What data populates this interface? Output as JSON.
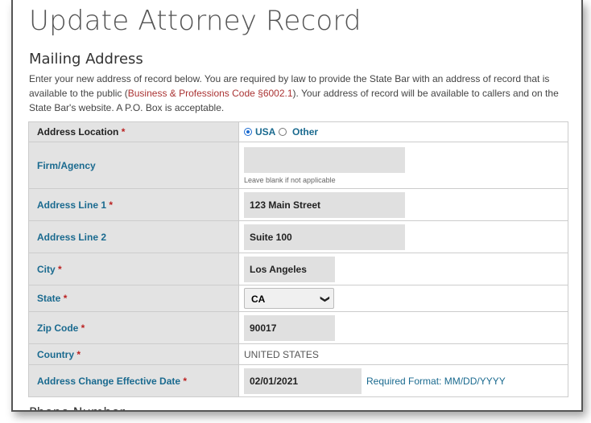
{
  "page": {
    "title": "Update Attorney Record",
    "section_title": "Mailing Address",
    "intro_1": "Enter your new address of record below. You are required by law to provide the State Bar with an address of record that is available to the public (",
    "intro_link": "Business & Professions Code §6002.1",
    "intro_2": "). Your address of record will be available to callers and on the State Bar's website. A P.O. Box is acceptable.",
    "next_section_partial": "Phone Number"
  },
  "form": {
    "address_location": {
      "label": "Address Location",
      "req": "*",
      "options": [
        "USA",
        "Other"
      ],
      "selected": "USA"
    },
    "firm": {
      "label": "Firm/Agency",
      "value": "",
      "hint": "Leave blank if not applicable"
    },
    "line1": {
      "label": "Address Line 1",
      "req": "*",
      "value": "123 Main Street"
    },
    "line2": {
      "label": "Address Line 2",
      "value": "Suite 100"
    },
    "city": {
      "label": "City",
      "req": "*",
      "value": "Los Angeles"
    },
    "state": {
      "label": "State",
      "req": "*",
      "value": "CA"
    },
    "zip": {
      "label": "Zip Code",
      "req": "*",
      "value": "90017"
    },
    "country": {
      "label": "Country",
      "req": "*",
      "value": "UNITED STATES"
    },
    "effective_date": {
      "label": "Address Change Effective Date",
      "req": "*",
      "value": "02/01/2021",
      "format": "Required Format: MM/DD/YYYY"
    }
  },
  "icons": {
    "radio_selected": "radio-selected-icon",
    "radio_unselected": "radio-unselected-icon",
    "dropdown": "chevron-down-icon"
  },
  "colors": {
    "label_blue": "#1a6a8f",
    "required_red": "#b22222",
    "link_red": "#aa3333",
    "input_bg": "#e0e0e0"
  }
}
